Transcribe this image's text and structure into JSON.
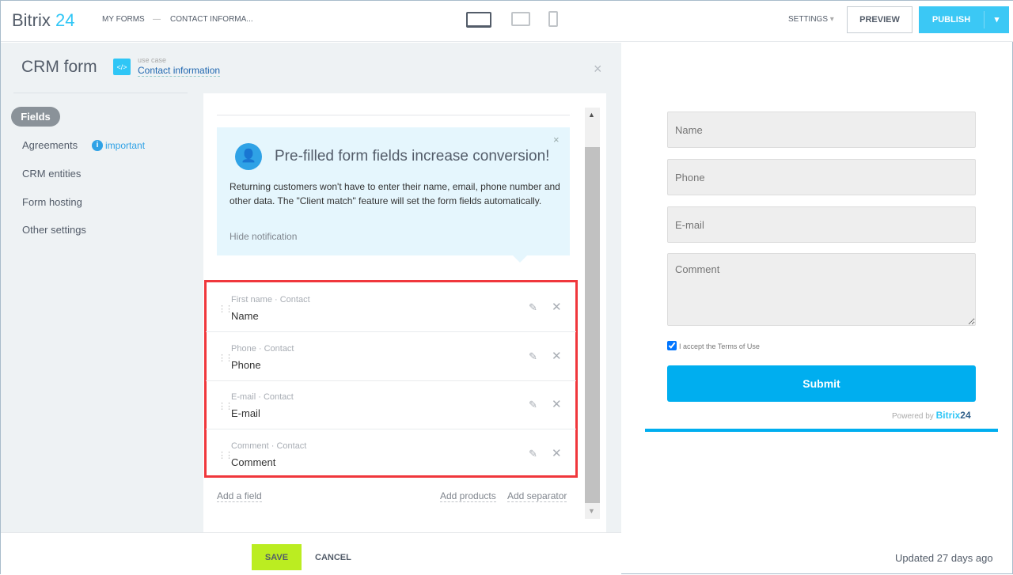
{
  "header": {
    "logo_main": "Bitrix",
    "logo_num": "24",
    "breadcrumb": [
      "MY FORMS",
      "—",
      "CONTACT INFORMA..."
    ],
    "settings": "SETTINGS",
    "preview": "PREVIEW",
    "publish": "PUBLISH"
  },
  "panel": {
    "title": "CRM form",
    "use_case_label": "use case",
    "use_case_value": "Contact information"
  },
  "sidebar": {
    "items": [
      {
        "label": "Fields",
        "active": true
      },
      {
        "label": "Agreements",
        "badge": "important"
      },
      {
        "label": "CRM entities"
      },
      {
        "label": "Form hosting"
      },
      {
        "label": "Other settings"
      }
    ]
  },
  "notification": {
    "title": "Pre-filled form fields increase conversion!",
    "body": "Returning customers won't have to enter their name, email, phone number and other data. The \"Client match\" feature will set the form fields automatically.",
    "hide": "Hide notification"
  },
  "fields": [
    {
      "sub": "First name · Contact",
      "name": "Name"
    },
    {
      "sub": "Phone · Contact",
      "name": "Phone"
    },
    {
      "sub": "E-mail · Contact",
      "name": "E-mail"
    },
    {
      "sub": "Comment · Contact",
      "name": "Comment"
    }
  ],
  "actions": {
    "add_field": "Add a field",
    "add_products": "Add products",
    "add_separator": "Add separator"
  },
  "preview": {
    "placeholders": [
      "Name",
      "Phone",
      "E-mail",
      "Comment"
    ],
    "terms": "I accept the Terms of Use",
    "terms_checked": true,
    "submit": "Submit",
    "powered_by": "Powered by",
    "brand": "Bitrix",
    "brand_num": "24"
  },
  "footer": {
    "save": "SAVE",
    "cancel": "CANCEL",
    "updated": "Updated 27 days ago"
  },
  "colors": {
    "accent": "#2fc6f6",
    "submit": "#00aeef",
    "save": "#bbed21",
    "highlight": "#f0373c"
  }
}
